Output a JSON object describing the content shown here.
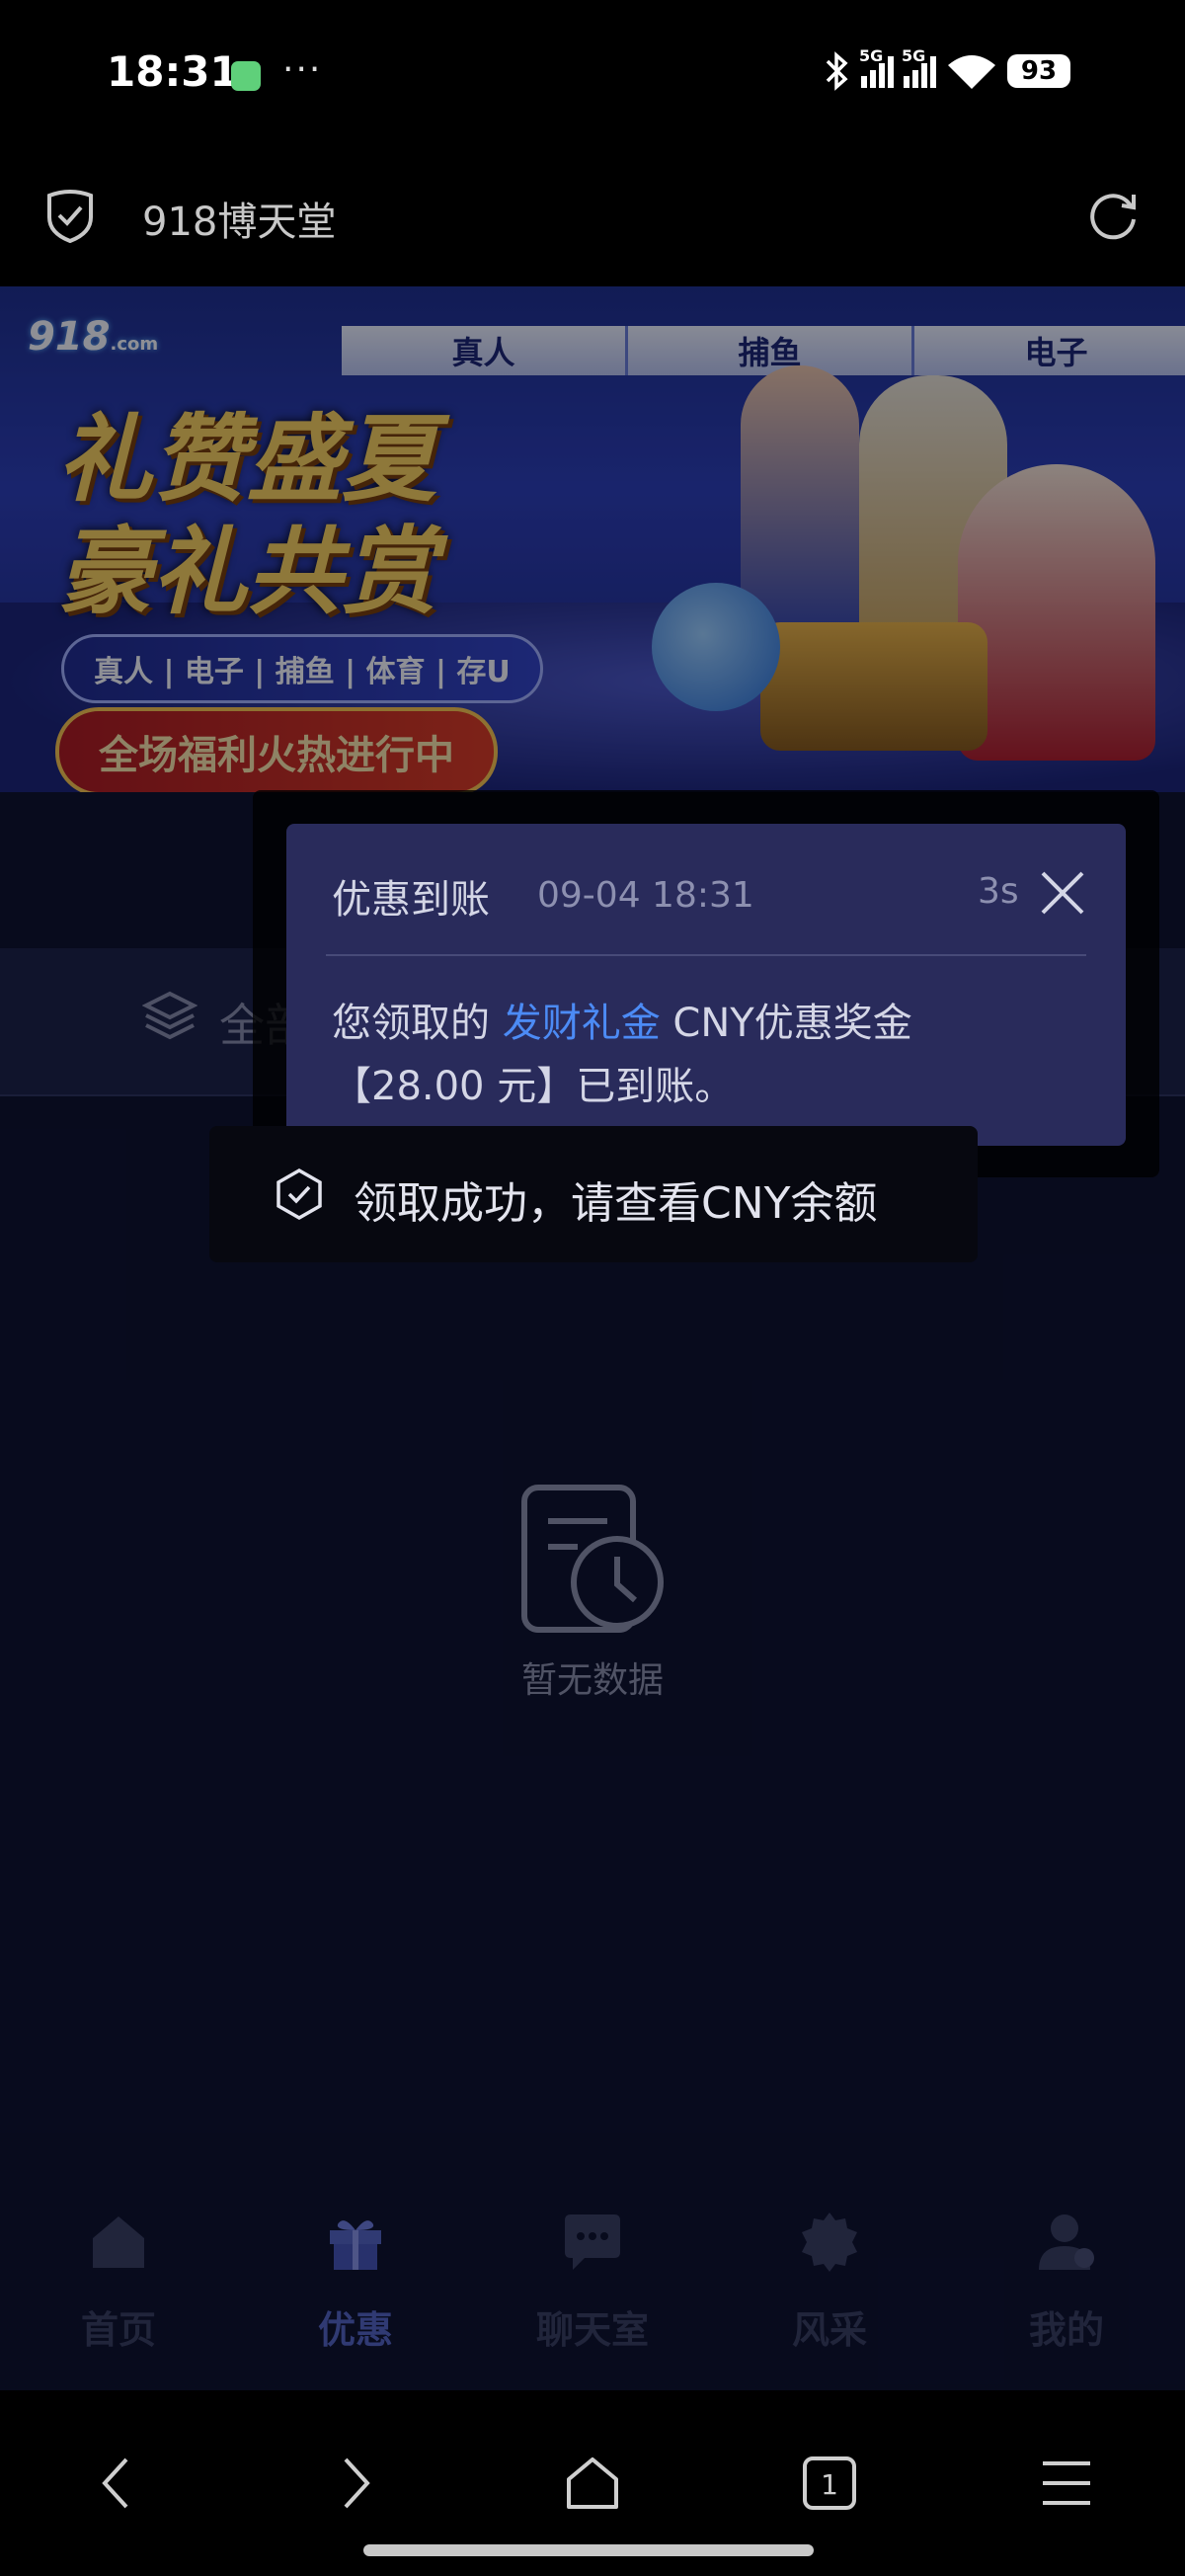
{
  "status_bar": {
    "time": "18:31",
    "dots": "···",
    "network_1": "5G",
    "network_2": "5G",
    "battery": "93"
  },
  "browser": {
    "title": "918博天堂"
  },
  "banner": {
    "logo": "918",
    "logo_small": ".com",
    "tabs": [
      "真人",
      "捕鱼",
      "电子"
    ],
    "headline_1": "礼赞盛夏",
    "headline_2": "豪礼共赏",
    "categories": "真人 | 电子 | 捕鱼 | 体育 | 存U",
    "slogan": "全场福利火热进行中"
  },
  "filter": {
    "label": "全部"
  },
  "empty_state": {
    "label": "暂无数据"
  },
  "notification": {
    "title": "优惠到账",
    "time": "09-04 18:31",
    "countdown": "3s",
    "body_prefix": "您领取的 ",
    "body_highlight": "发财礼金",
    "body_suffix": " CNY优惠奖金",
    "body_line2": "【28.00 元】已到账。"
  },
  "toast": {
    "text": "领取成功，请查看CNY余额"
  },
  "tab_bar": {
    "items": [
      {
        "label": "首页",
        "icon": "home-icon"
      },
      {
        "label": "优惠",
        "icon": "gift-icon"
      },
      {
        "label": "聊天室",
        "icon": "chat-icon"
      },
      {
        "label": "风采",
        "icon": "badge-icon"
      },
      {
        "label": "我的",
        "icon": "profile-icon"
      }
    ],
    "active_index": 1
  },
  "system_nav": {
    "tab_count": "1"
  },
  "colors": {
    "accent": "#4c8bf5",
    "page_bg": "#0c0f26",
    "popup_bg": "#292b5b",
    "active_tab": "#5564c2"
  }
}
